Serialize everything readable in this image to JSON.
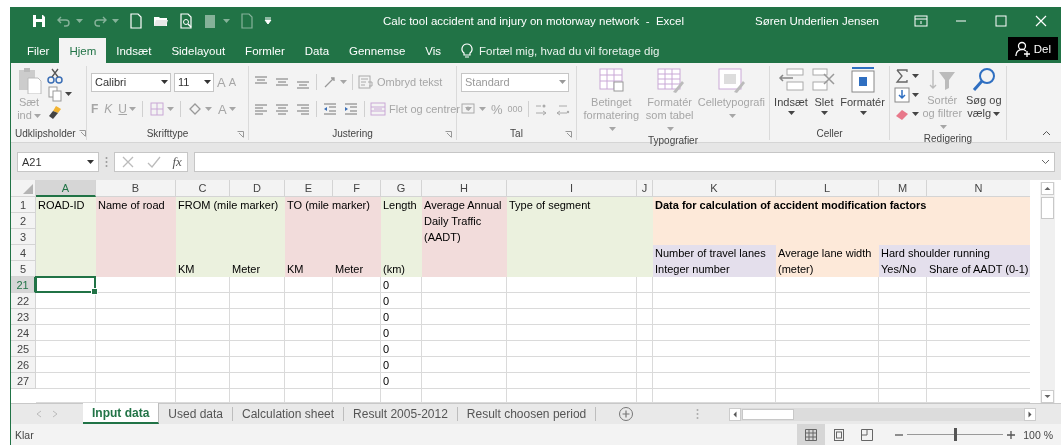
{
  "window": {
    "title": "Calc tool accident and injury on motorway network  -  Excel",
    "user": "Søren Underlien Jensen"
  },
  "tabs": [
    {
      "label": "Filer",
      "selected": false
    },
    {
      "label": "Hjem",
      "selected": true
    },
    {
      "label": "Indsæt",
      "selected": false
    },
    {
      "label": "Sidelayout",
      "selected": false
    },
    {
      "label": "Formler",
      "selected": false
    },
    {
      "label": "Data",
      "selected": false
    },
    {
      "label": "Gennemse",
      "selected": false
    },
    {
      "label": "Vis",
      "selected": false
    }
  ],
  "tell_me": {
    "placeholder": "Fortæl mig, hvad du vil foretage dig"
  },
  "share_button": {
    "label": "Del"
  },
  "ribbon": {
    "clipboard": {
      "label": "Udklipsholder",
      "paste": {
        "label": "Sæt ind",
        "disabled": true
      }
    },
    "font": {
      "label": "Skrifttype",
      "font_name": "Calibri",
      "font_size": "11",
      "grow": "A",
      "shrink": "A",
      "bold": "F",
      "italic": "K",
      "underline": "U",
      "font_color": "A",
      "disabled": true
    },
    "alignment": {
      "label": "Justering",
      "wrap_text": {
        "label": "Ombryd tekst",
        "disabled": true
      },
      "merge": {
        "label": "Flet og centrer",
        "disabled": true
      }
    },
    "number": {
      "label": "Tal",
      "format": "Standard",
      "percent": "%",
      "thousands": "000",
      "disabled": true
    },
    "styles": {
      "label": "Typografier",
      "buttons": [
        {
          "label": "Betinget formatering",
          "disabled": true
        },
        {
          "label": "Formatér som tabel",
          "disabled": true
        },
        {
          "label": "Celletypografi",
          "disabled": true
        }
      ]
    },
    "cells": {
      "label": "Celler",
      "buttons": [
        {
          "label": "Indsæt",
          "disabled": false
        },
        {
          "label": "Slet",
          "disabled": false
        },
        {
          "label": "Formatér",
          "disabled": false
        }
      ]
    },
    "editing": {
      "label": "Redigering",
      "sort": {
        "label": "Sortér og filtrer",
        "disabled": true
      },
      "find": {
        "label": "Søg og vælg",
        "disabled": false
      }
    }
  },
  "formula_bar": {
    "name_box": "A21",
    "function_label": "fx"
  },
  "header_blocks": [
    {
      "color": "#ebf1de",
      "lines": [
        "ROAD-ID"
      ],
      "columns": [
        {
          "label": "A",
          "selected": true
        }
      ]
    },
    {
      "color": "#f2dcdb",
      "lines": [
        "Name of road"
      ],
      "columns": [
        {
          "label": "B",
          "selected": false
        }
      ]
    },
    {
      "color": "#ebf1de",
      "lines": [
        "FROM (mile marker)"
      ],
      "columns": [
        {
          "label": "C",
          "selected": false,
          "unit": "KM"
        },
        {
          "label": "D",
          "selected": false,
          "unit": "Meter"
        }
      ]
    },
    {
      "color": "#f2dcdb",
      "lines": [
        "TO (mile marker)"
      ],
      "columns": [
        {
          "label": "E",
          "selected": false,
          "unit": "KM"
        },
        {
          "label": "F",
          "selected": false,
          "unit": "Meter"
        }
      ]
    },
    {
      "color": "#ebf1de",
      "lines": [
        "Length"
      ],
      "columns": [
        {
          "label": "G",
          "selected": false,
          "unit": "(km)"
        }
      ]
    },
    {
      "color": "#f2dcdb",
      "lines": [
        "Average Annual",
        "Daily Traffic",
        "(AADT)"
      ],
      "columns": [
        {
          "label": "H",
          "selected": false
        }
      ]
    },
    {
      "color": "#ebf1de",
      "lines": [
        "Type of segment"
      ],
      "columns": [
        {
          "label": "I",
          "selected": false
        },
        {
          "label": "J",
          "selected": false
        }
      ]
    },
    {
      "color": "#fde9d9",
      "bold": true,
      "lines": [
        "Data for calculation of accident modification factors"
      ],
      "subblocks": [
        {
          "color": "#e4dfec",
          "lines": [
            "Number of travel lanes"
          ],
          "columns": [
            {
              "label": "K",
              "selected": false,
              "unit": "Integer number"
            }
          ]
        },
        {
          "color": "#fde9d9",
          "lines": [
            "Average lane width"
          ],
          "columns": [
            {
              "label": "L",
              "selected": false,
              "unit": "(meter)"
            }
          ]
        },
        {
          "color": "#e4dfec",
          "lines": [
            "Hard shoulder running"
          ],
          "columns": [
            {
              "label": "M",
              "selected": false,
              "unit": "Yes/No"
            },
            {
              "label": "N",
              "selected": false,
              "unit": "Share of AADT (0-1)"
            }
          ]
        }
      ]
    }
  ],
  "rows": [
    {
      "label": "1",
      "selected": false
    },
    {
      "label": "2",
      "selected": false
    },
    {
      "label": "3",
      "selected": false
    },
    {
      "label": "4",
      "selected": false
    },
    {
      "label": "5",
      "selected": false
    },
    {
      "label": "21",
      "selected": true,
      "length": "0"
    },
    {
      "label": "22",
      "selected": false,
      "length": "0"
    },
    {
      "label": "23",
      "selected": false,
      "length": "0"
    },
    {
      "label": "24",
      "selected": false,
      "length": "0"
    },
    {
      "label": "25",
      "selected": false,
      "length": "0"
    },
    {
      "label": "26",
      "selected": false,
      "length": "0"
    },
    {
      "label": "27",
      "selected": false,
      "length": "0"
    }
  ],
  "sheet_tabs": [
    {
      "label": "Input data",
      "selected": true
    },
    {
      "label": "Used data",
      "selected": false
    },
    {
      "label": "Calculation sheet",
      "selected": false
    },
    {
      "label": "Result 2005-2012",
      "selected": false
    },
    {
      "label": "Result choosen period",
      "selected": false
    }
  ],
  "status_bar": {
    "status": "Klar",
    "views": [
      {
        "selected": true
      },
      {
        "selected": false
      },
      {
        "selected": false
      }
    ],
    "zoom": {
      "level": 0.5,
      "reading": "100 %"
    }
  }
}
